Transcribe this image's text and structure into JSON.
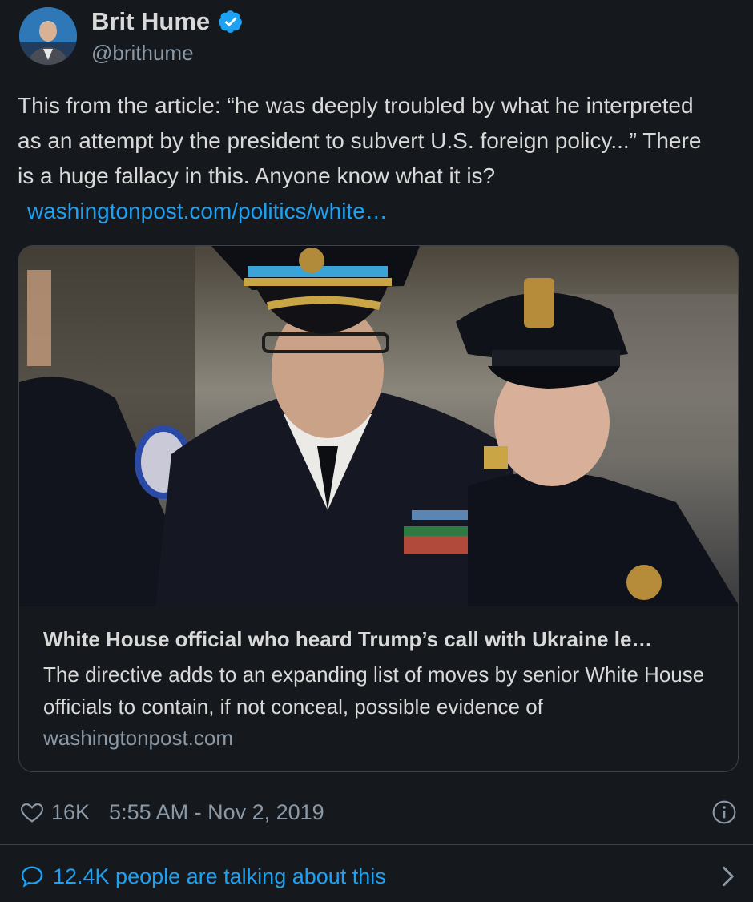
{
  "author": {
    "display_name": "Brit Hume",
    "handle": "@brithume",
    "verified": true
  },
  "tweet": {
    "text": "This from the article: “he was deeply troubled by what he interpreted as an attempt by the president to subvert U.S. foreign policy...” There is a huge fallacy in this. Anyone know what it is?",
    "link_text": "washingtonpost.com/politics/white…"
  },
  "card": {
    "title": "White House official who heard Trump’s call with Ukraine le…",
    "description": "The directive adds to an expanding list of moves by senior White House officials to contain, if not conceal, possible evidence of",
    "domain": "washingtonpost.com"
  },
  "stats": {
    "likes": "16K",
    "timestamp": "5:55 AM - Nov 2, 2019"
  },
  "conversation": {
    "label": "12.4K people are talking about this"
  },
  "colors": {
    "background": "#15181c",
    "accent": "#1da1f2",
    "text": "#d9d9d9",
    "muted": "#8b98a5",
    "border": "#3d4148"
  },
  "icons": [
    "verified-badge-icon",
    "heart-icon",
    "info-icon",
    "speech-bubble-icon",
    "chevron-right-icon"
  ]
}
